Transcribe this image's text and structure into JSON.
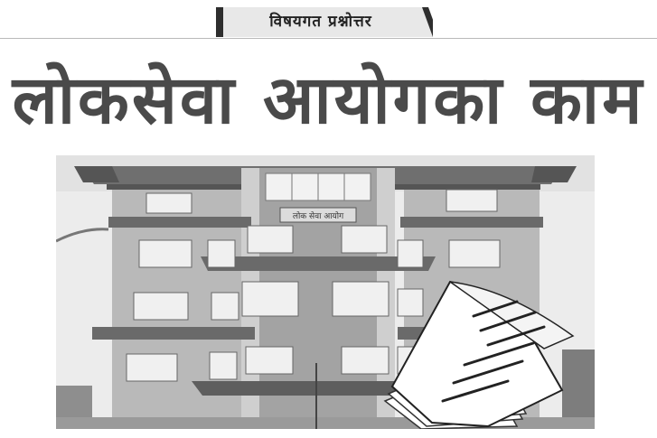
{
  "section_tag": {
    "label": "विषयगत प्रश्नोत्तर"
  },
  "headline": {
    "text": "लोकसेवा आयोगका काम"
  },
  "photo": {
    "subject": "building-with-document-icon",
    "building_sign": "लोक सेवा आयोग"
  },
  "colors": {
    "headline": "#4a4a4a",
    "tag_bar": "#333333",
    "tag_bg": "#e6e6e6",
    "rule": "#b9b9b9",
    "sky": "#e9e9e9"
  }
}
